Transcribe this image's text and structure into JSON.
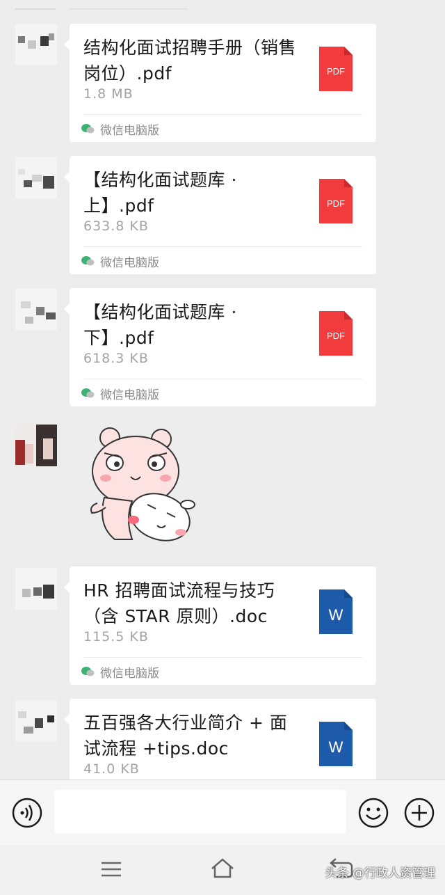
{
  "messages": [
    {
      "file_name": "结构化面试招聘手册（销售岗位）.pdf",
      "file_size": "1.8  MB",
      "file_type": "PDF",
      "source": "微信电脑版"
    },
    {
      "file_name": "【结构化面试题库 · 上】.pdf",
      "file_size": "633.8  KB",
      "file_type": "PDF",
      "source": "微信电脑版"
    },
    {
      "file_name": "【结构化面试题库 · 下】.pdf",
      "file_size": "618.3  KB",
      "file_type": "PDF",
      "source": "微信电脑版"
    },
    {
      "file_name": "HR 招聘面试流程与技巧（含 STAR 原则）.doc",
      "file_size": "115.5  KB",
      "file_type": "W",
      "source": "微信电脑版"
    },
    {
      "file_name": "五百强各大行业简介 + 面试流程 +tips.doc",
      "file_size": "41.0  KB",
      "file_type": "W"
    }
  ],
  "colors": {
    "pdf_red": "#f23b3d",
    "word_blue": "#1f5bab",
    "wechat_green": "#3cb371"
  },
  "icons": {
    "voice": "voice-icon",
    "emoji": "emoji-icon",
    "plus": "plus-icon",
    "menu": "menu-icon",
    "home": "home-icon",
    "back": "back-icon"
  },
  "watermark": "头条 @行政人资管理"
}
